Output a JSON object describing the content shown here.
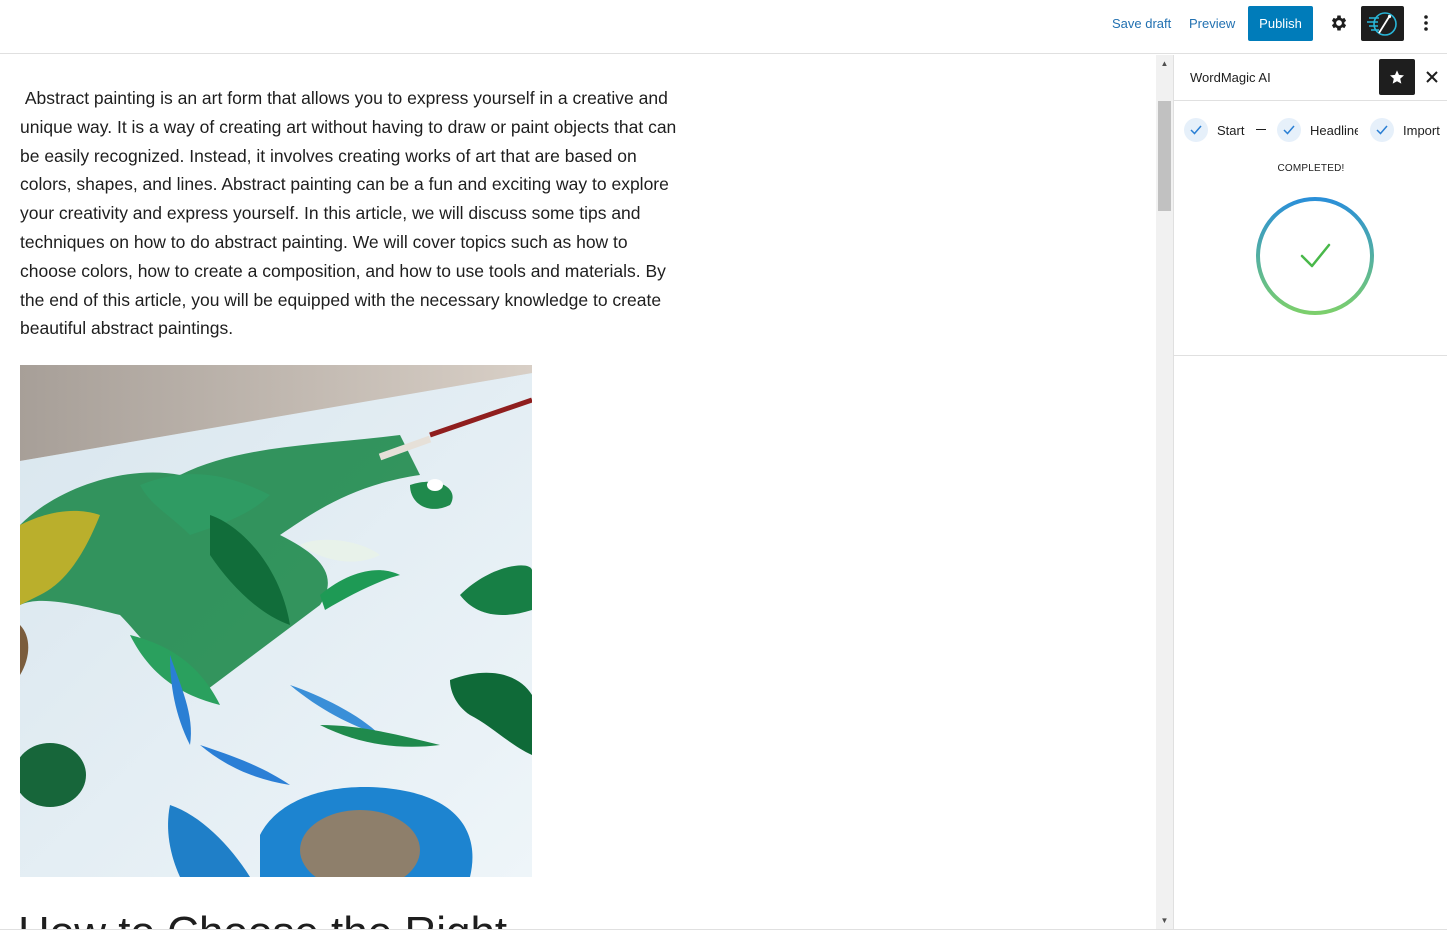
{
  "topbar": {
    "save_draft": "Save draft",
    "preview": "Preview",
    "publish": "Publish",
    "icons": [
      "gear-icon",
      "wordmagic-logo-icon",
      "more-vertical-icon"
    ],
    "accent_color": "#007cba"
  },
  "editor": {
    "paragraph": " Abstract painting is an art form that allows you to express yourself in a creative and unique way. It is a way of creating art without having to draw or paint objects that can be easily recognized. Instead, it involves creating works of art that are based on colors, shapes, and lines. Abstract painting can be a fun and exciting way to explore your creativity and express yourself. In this article, we will discuss some tips and techniques on how to do abstract painting. We will cover topics such as how to choose colors, how to create a composition, and how to use tools and materials. By the end of this article, you will be equipped with the necessary knowledge to create beautiful abstract paintings.",
    "image_description_icon": "abstract-painting-image",
    "next_heading_partial": "How to Choose the Right"
  },
  "sidebar": {
    "title": "WordMagic AI",
    "steps": [
      {
        "label": "Start",
        "done": true
      },
      {
        "label": "Headline",
        "done": true
      },
      {
        "label": "Import",
        "done": true
      }
    ],
    "status": "COMPLETED!",
    "progress": 1.0,
    "ring_colors": [
      "#2a8fd8",
      "#7ccf6c"
    ],
    "check_color": "#49b84a"
  }
}
